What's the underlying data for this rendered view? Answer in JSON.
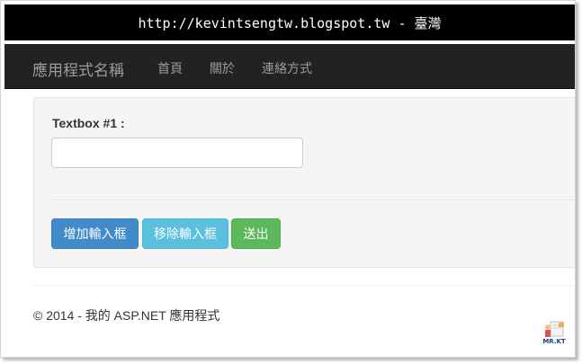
{
  "watermark": {
    "text": "http://kevintsengtw.blogspot.tw - 臺灣"
  },
  "navbar": {
    "brand": "應用程式名稱",
    "items": [
      {
        "label": "首頁"
      },
      {
        "label": "關於"
      },
      {
        "label": "連絡方式"
      }
    ]
  },
  "form": {
    "textbox_label": "Textbox #1 :",
    "textbox_value": ""
  },
  "buttons": {
    "add": "增加輸入框",
    "remove": "移除輸入框",
    "submit": "送出"
  },
  "footer": {
    "copyright": "© 2014 - 我的 ASP.NET 應用程式"
  },
  "logo": {
    "text": "MR.KT"
  },
  "colors": {
    "navbar_bg": "#222222",
    "primary": "#428bca",
    "info": "#5bc0de",
    "success": "#5cb85c"
  }
}
